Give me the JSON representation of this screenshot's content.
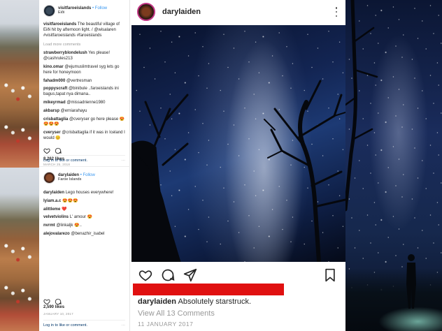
{
  "feed": {
    "post1": {
      "username": "visitfaroeislands",
      "follow": "• Follow",
      "location": "Eiði",
      "caption_user": "visitfaroeislands",
      "caption_text": "The beautiful village of Eiði hit by afternoon light. / @wisalaren #visitfaroeislands #faroeislands",
      "load_more": "Load more comments",
      "comments": [
        {
          "user": "strawberryblondelush",
          "text": "Yes please! @cashrules213"
        },
        {
          "user": "kino.omar",
          "text": "@ejumuslimtravel syg lets go here for honeymoon"
        },
        {
          "user": "fahadm000",
          "text": "@vertresman"
        },
        {
          "user": "poppyscraft",
          "text": "@binibule ..faroeislands ini bagus,tapat nya dimana.."
        },
        {
          "user": "mikeyrmad",
          "text": "@missadrienne1980"
        },
        {
          "user": "akbarsp",
          "text": "@erniarahayu"
        },
        {
          "user": "crisbattaglia",
          "text": "@cveryser go here please 😍😍😍😍"
        },
        {
          "user": "cveryser",
          "text": "@crisbattaglia if it was in Iceland I would 😊"
        }
      ],
      "likes": "8,262 likes",
      "date": "MARCH 25, 2018",
      "login_text": "Log in to like or comment."
    },
    "post2": {
      "username": "darylaiden",
      "follow": "• Follow",
      "location": "Faroe Islands",
      "caption_user": "darylaiden",
      "caption_text": "Lego houses everywhere!",
      "comments": [
        {
          "user": "lyiam.a.c",
          "text": "😍😍😍"
        },
        {
          "user": "alittleme",
          "text": "❤️"
        },
        {
          "user": "velvetviolins",
          "text": "L' amour 😍"
        },
        {
          "user": "nvrmt",
          "text": "@linkaljk 😍.."
        },
        {
          "user": "alejovalarezo",
          "text": "@benazhir_isabel"
        }
      ],
      "likes": "2,590 likes",
      "date": "JANUARY 10, 2017",
      "login_text": "Log in to like or comment."
    },
    "more_dots": "···"
  },
  "card": {
    "username": "darylaiden",
    "caption_user": "darylaiden",
    "caption_text": "Absolutely starstruck.",
    "view_comments": "View All 13 Comments",
    "date": "11 JANUARY 2017"
  },
  "colors": {
    "follow_blue": "#3897f0",
    "redaction": "#e01010",
    "link": "#003569"
  }
}
